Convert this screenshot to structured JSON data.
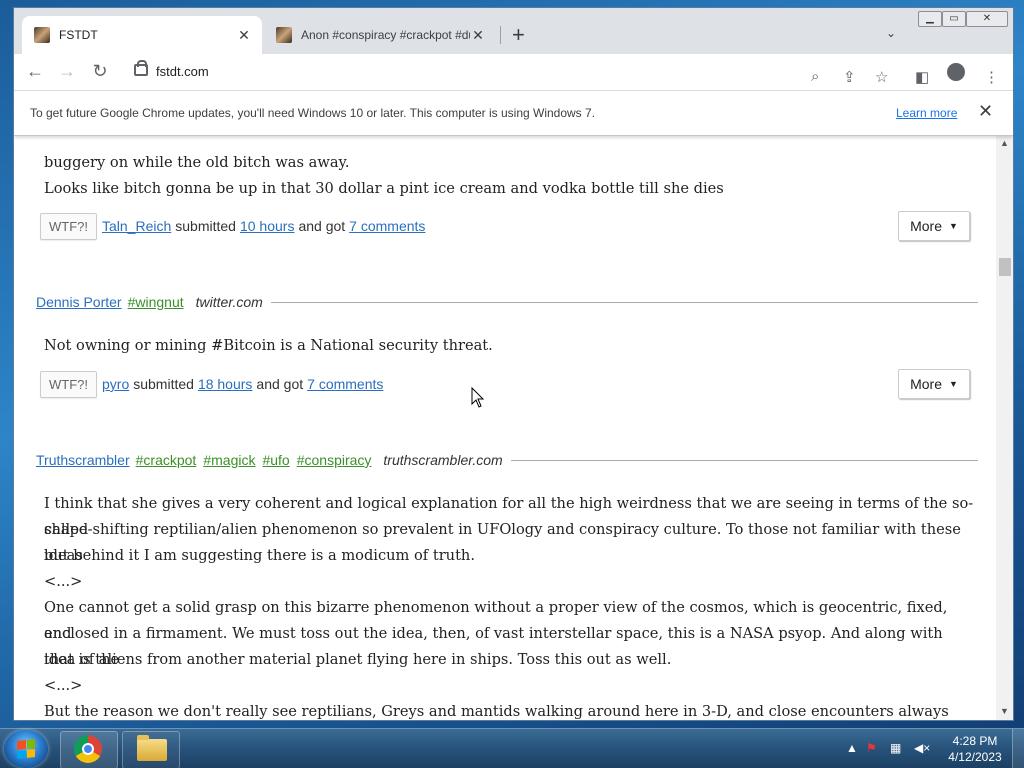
{
  "browser": {
    "tabs": [
      {
        "title": "FSTDT",
        "active": true
      },
      {
        "title": "Anon #conspiracy #crackpot #du",
        "active": false
      }
    ],
    "new_tab": "+",
    "tab_search": "⌄",
    "url": "fstdt.com",
    "window_controls": {
      "minimize": "▭",
      "maximize": "◻",
      "close": "✕"
    },
    "infobar": {
      "message": "To get future Google Chrome updates, you'll need Windows 10 or later. This computer is using Windows 7.",
      "link": "Learn more",
      "close": "✕"
    }
  },
  "feed": {
    "top_partial": {
      "line1": "buggery on while the old bitch was away.",
      "line2": "Looks like bitch gonna be up in that 30 dollar a pint ice cream and vodka bottle till she dies",
      "meta": {
        "wtf": "WTF?!",
        "user": "Taln_Reich",
        "submitted": "submitted",
        "age": "10 hours",
        "and_got": "and got",
        "comments": "7 comments",
        "more": "More"
      }
    },
    "post2": {
      "author": "Dennis Porter",
      "tags": [
        "#wingnut"
      ],
      "source": "twitter.com",
      "body": "Not owning or mining #Bitcoin is a National security threat.",
      "meta": {
        "wtf": "WTF?!",
        "user": "pyro",
        "submitted": "submitted",
        "age": "18 hours",
        "and_got": "and got",
        "comments": "7 comments",
        "more": "More"
      }
    },
    "post3": {
      "author": "Truthscrambler",
      "tags": [
        "#crackpot",
        "#magick",
        "#ufo",
        "#conspiracy"
      ],
      "source": "truthscrambler.com",
      "lines": [
        "I think that she gives a very coherent and logical explanation for all the high weirdness that we are seeing in terms of the so-called",
        "shape-shifting reptilian/alien phenomenon so prevalent in UFOlogy and conspiracy culture. To those not familiar with these ideas",
        "but behind it I am suggesting there is a modicum of truth.",
        "<...>",
        "One cannot get a solid grasp on this bizarre phenomenon without a proper view of the cosmos, which is geocentric, fixed, and",
        "enclosed in a firmament. We must toss out the idea, then, of vast interstellar space, this is a NASA psyop. And along with that is the",
        "idea of aliens from another material planet flying here in ships. Toss this out as well.",
        "<...>",
        "But the reason we don't really see reptilians, Greys and mantids walking around here in 3-D, and close encounters always seem to"
      ]
    }
  },
  "taskbar": {
    "time": "4:28 PM",
    "date": "4/12/2023"
  },
  "colors": {
    "link": "#2a6fbd",
    "tag": "#3c8f2a",
    "accent": "#1a73e8"
  }
}
